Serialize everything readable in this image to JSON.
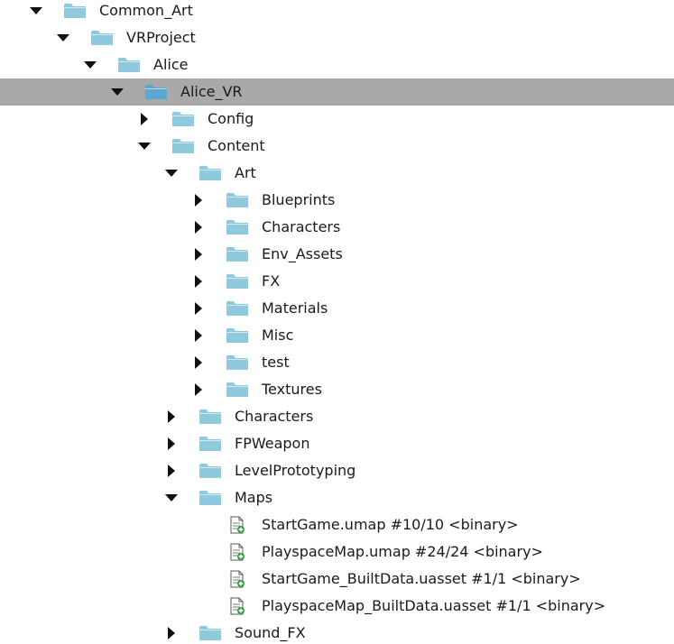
{
  "tree": {
    "rows": [
      {
        "label": "Common_Art",
        "depth": 0,
        "kind": "folder",
        "state": "expanded"
      },
      {
        "label": "VRProject",
        "depth": 1,
        "kind": "folder",
        "state": "expanded"
      },
      {
        "label": "Alice",
        "depth": 2,
        "kind": "folder",
        "state": "expanded"
      },
      {
        "label": "Alice_VR",
        "depth": 3,
        "kind": "folder",
        "state": "expanded",
        "selected": true
      },
      {
        "label": "Config",
        "depth": 4,
        "kind": "folder",
        "state": "collapsed"
      },
      {
        "label": "Content",
        "depth": 4,
        "kind": "folder",
        "state": "expanded"
      },
      {
        "label": "Art",
        "depth": 5,
        "kind": "folder",
        "state": "expanded"
      },
      {
        "label": "Blueprints",
        "depth": 6,
        "kind": "folder",
        "state": "collapsed"
      },
      {
        "label": "Characters",
        "depth": 6,
        "kind": "folder",
        "state": "collapsed"
      },
      {
        "label": "Env_Assets",
        "depth": 6,
        "kind": "folder",
        "state": "collapsed"
      },
      {
        "label": "FX",
        "depth": 6,
        "kind": "folder",
        "state": "collapsed"
      },
      {
        "label": "Materials",
        "depth": 6,
        "kind": "folder",
        "state": "collapsed"
      },
      {
        "label": "Misc",
        "depth": 6,
        "kind": "folder",
        "state": "collapsed"
      },
      {
        "label": "test",
        "depth": 6,
        "kind": "folder",
        "state": "collapsed"
      },
      {
        "label": "Textures",
        "depth": 6,
        "kind": "folder",
        "state": "collapsed"
      },
      {
        "label": "Characters",
        "depth": 5,
        "kind": "folder",
        "state": "collapsed"
      },
      {
        "label": "FPWeapon",
        "depth": 5,
        "kind": "folder",
        "state": "collapsed"
      },
      {
        "label": "LevelPrototyping",
        "depth": 5,
        "kind": "folder",
        "state": "collapsed"
      },
      {
        "label": "Maps",
        "depth": 5,
        "kind": "folder",
        "state": "expanded"
      },
      {
        "label": "StartGame.umap #10/10 <binary>",
        "depth": 6,
        "kind": "file"
      },
      {
        "label": "PlayspaceMap.umap #24/24 <binary>",
        "depth": 6,
        "kind": "file"
      },
      {
        "label": "StartGame_BuiltData.uasset #1/1 <binary>",
        "depth": 6,
        "kind": "file"
      },
      {
        "label": "PlayspaceMap_BuiltData.uasset #1/1 <binary>",
        "depth": 6,
        "kind": "file"
      },
      {
        "label": "Sound_FX",
        "depth": 5,
        "kind": "folder",
        "state": "collapsed"
      }
    ]
  },
  "colors": {
    "folder": "#8ec9de",
    "folder_selected": "#5aa8cf",
    "selected_row": "#a9a9a9",
    "add_badge": "#2e9e3e"
  },
  "icons": {
    "folder": "folder-icon",
    "file": "file-add-icon",
    "expanded": "triangle-down-icon",
    "collapsed": "triangle-right-icon"
  }
}
